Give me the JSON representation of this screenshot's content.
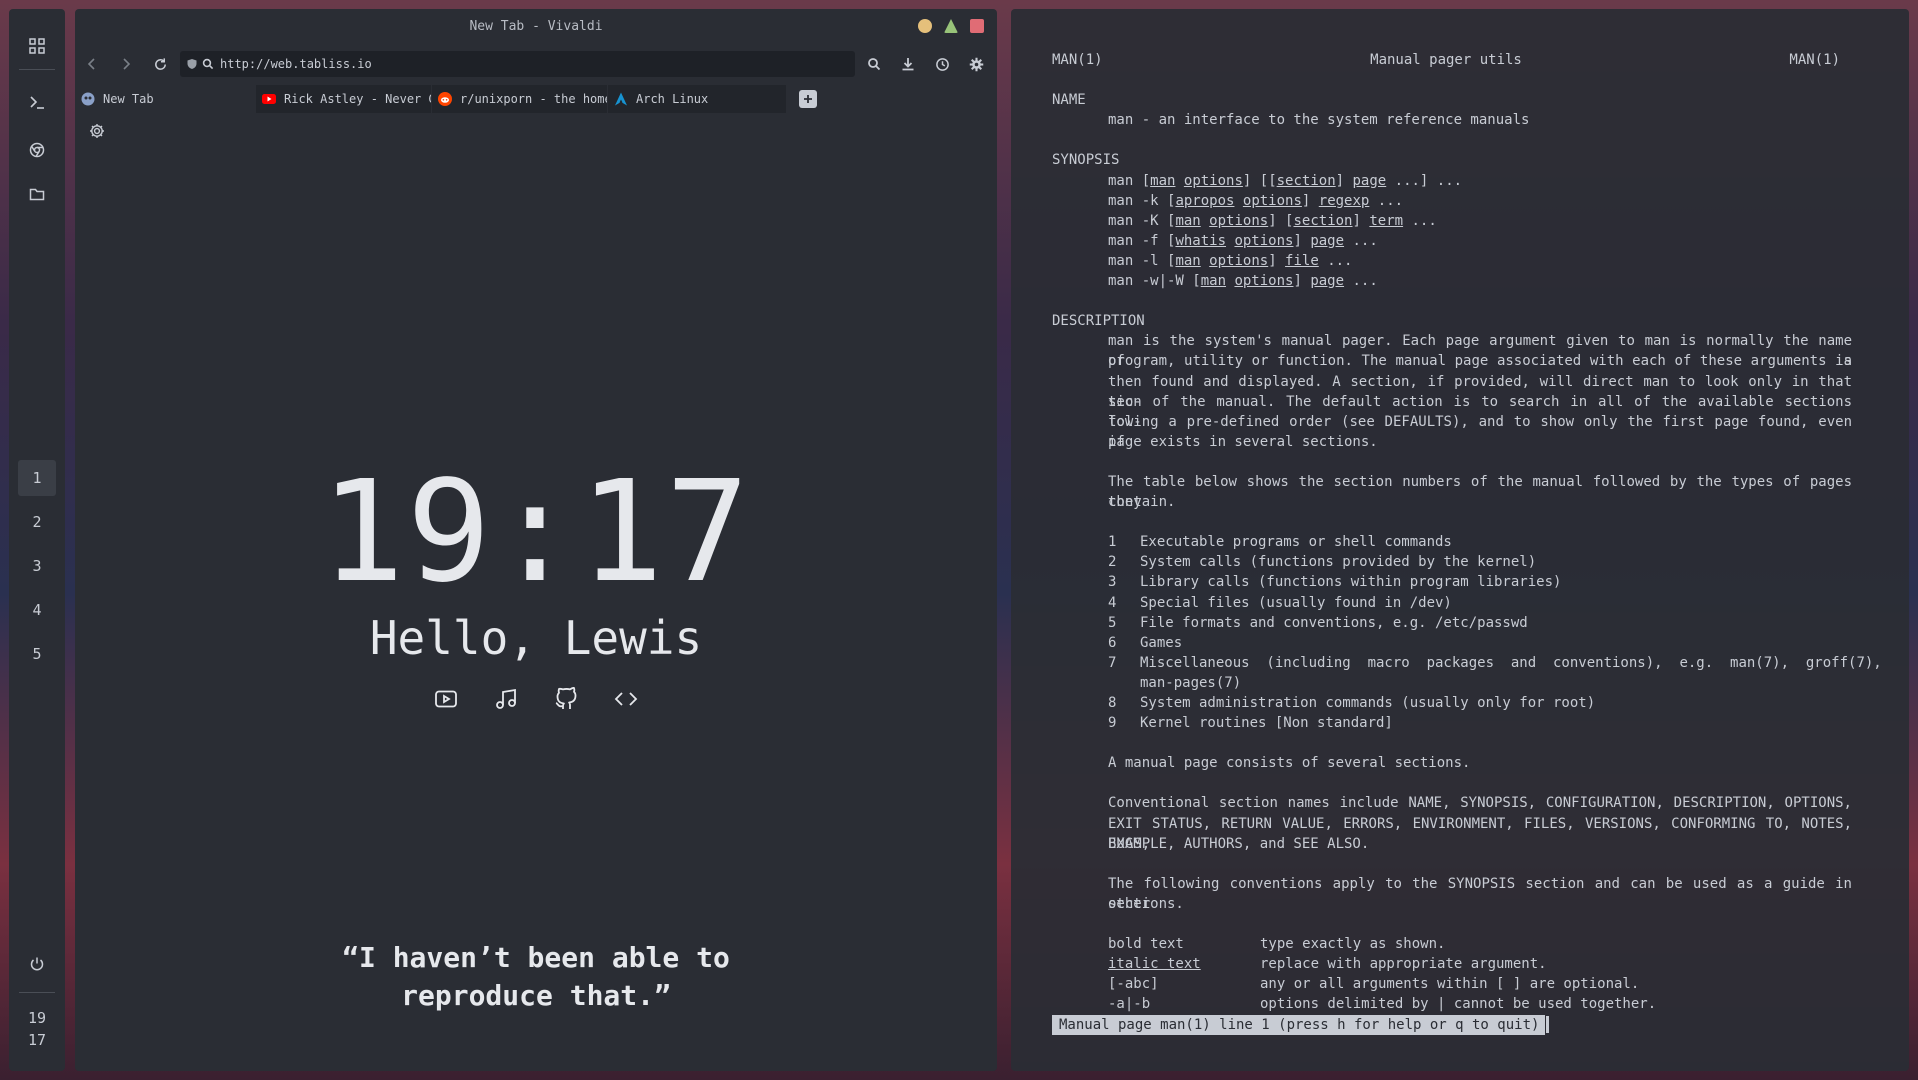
{
  "dock": {
    "workspaces": [
      "1",
      "2",
      "3",
      "4",
      "5"
    ],
    "active_workspace": "1",
    "clock_hour": "19",
    "clock_minute": "17"
  },
  "browser": {
    "window_title": "New Tab - Vivaldi",
    "url": "http://web.tabliss.io",
    "tabs": [
      {
        "label": "New Tab",
        "icon": "vivaldi-icon",
        "selected": true
      },
      {
        "label": "Rick Astley - Never Gonna Give You Up",
        "icon": "youtube-icon",
        "selected": false
      },
      {
        "label": "r/unixporn - the home for",
        "icon": "reddit-icon",
        "selected": false
      },
      {
        "label": "Arch Linux",
        "icon": "arch-icon",
        "selected": false
      }
    ],
    "newtab": {
      "time": "19:17",
      "greeting": "Hello, Lewis",
      "links": [
        "youtube-icon",
        "music-icon",
        "github-icon",
        "code-icon"
      ],
      "quote_line1": "“I haven’t been able to",
      "quote_line2": "reproduce that.”"
    },
    "colors": {
      "minimize": "#e5c07b",
      "maximize": "#98c379",
      "close": "#e06c75"
    }
  },
  "terminal": {
    "header_left": "MAN(1)",
    "header_center": "Manual pager utils",
    "header_right": "MAN(1)",
    "name_heading": "NAME",
    "name_text": "man - an interface to the system reference manuals",
    "synopsis_heading": "SYNOPSIS",
    "description_heading": "DESCRIPTION",
    "desc_p1": [
      "man is the system's manual pager.  Each page argument given to man is normally the name of a",
      "program, utility or function.  The manual page associated with each of  these  arguments  is",
      "then found and displayed.  A section, if provided, will direct man to look only in that sec-",
      "tion of the manual.  The default action is to search in all of the available  sections  fol-",
      "lowing  a  pre-defined  order (see DEFAULTS), and to show only the first page found, even if",
      "page exists in several sections."
    ],
    "desc_p2": [
      "The table below shows the section numbers of the manual followed by the types of pages  they",
      "contain."
    ],
    "sections": [
      {
        "num": "1",
        "text": "Executable programs or shell commands"
      },
      {
        "num": "2",
        "text": "System calls (functions provided by the kernel)"
      },
      {
        "num": "3",
        "text": "Library calls (functions within program libraries)"
      },
      {
        "num": "4",
        "text": "Special files (usually found in /dev)"
      },
      {
        "num": "5",
        "text": "File formats and conventions, e.g. /etc/passwd"
      },
      {
        "num": "6",
        "text": "Games"
      },
      {
        "num": "7",
        "text": "Miscellaneous  (including  macro  packages  and  conventions),  e.g.  man(7),  groff(7),"
      },
      {
        "num": "",
        "text": "man-pages(7)"
      },
      {
        "num": "8",
        "text": "System administration commands (usually only for root)"
      },
      {
        "num": "9",
        "text": "Kernel routines [Non standard]"
      }
    ],
    "desc_p3": "A manual page consists of several sections.",
    "desc_p4": [
      "Conventional section names include  NAME,  SYNOPSIS,  CONFIGURATION,  DESCRIPTION,  OPTIONS,",
      "EXIT STATUS, RETURN VALUE, ERRORS, ENVIRONMENT, FILES, VERSIONS, CONFORMING TO, NOTES, BUGS,",
      "EXAMPLE, AUTHORS, and SEE ALSO."
    ],
    "desc_p5": [
      "The following conventions apply to the SYNOPSIS section and can be used as a guide in  other",
      "sections."
    ],
    "conventions": [
      {
        "key": "bold text",
        "desc": "type exactly as shown."
      },
      {
        "key": "italic text",
        "desc": "replace with appropriate argument."
      },
      {
        "key": "[-abc]",
        "desc": "any or all arguments within [ ] are optional."
      },
      {
        "key": "-a|-b",
        "desc": "options delimited by | cannot be used together."
      }
    ],
    "status_line": "Manual page man(1) line 1 (press h for help or q to quit)"
  }
}
